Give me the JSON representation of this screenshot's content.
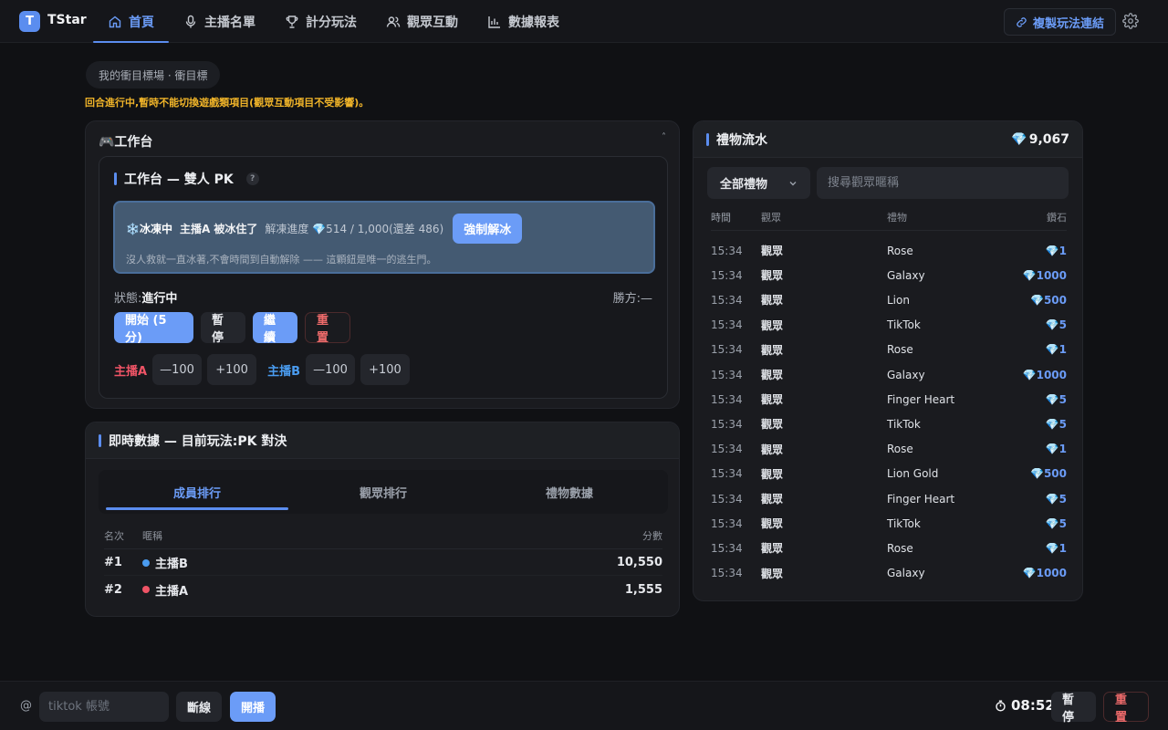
{
  "app": {
    "logo_letter": "T",
    "name": "TStar"
  },
  "nav": [
    {
      "label": "首頁",
      "icon": "home-icon",
      "active": true
    },
    {
      "label": "主播名單",
      "icon": "microphone-icon"
    },
    {
      "label": "計分玩法",
      "icon": "trophy-icon"
    },
    {
      "label": "觀眾互動",
      "icon": "users-icon"
    },
    {
      "label": "數據報表",
      "icon": "bar-chart-icon"
    }
  ],
  "header": {
    "copy_link_label": "複製玩法連結"
  },
  "stage": {
    "pill": "我的衝目標場 · 衝目標",
    "warning": "回合進行中,暫時不能切換遊戲類項目(觀眾互動項目不受影響)。"
  },
  "workbench": {
    "title": "🎮工作台",
    "collapse_glyph": "˄",
    "inner_title": "工作台 — 雙人 PK",
    "help": "?",
    "freeze": {
      "state": "❄️冰凍中",
      "who": "主播A 被冰住了",
      "progress": "解凍進度 💎514 / 1,000(還差 486)",
      "button": "強制解冰",
      "note": "沒人救就一直冰著,不會時間到自動解除 —— 這顆鈕是唯一的逃生門。"
    },
    "status_label": "狀態:",
    "status_value": "進行中",
    "winner": "勝方:—",
    "controls": {
      "start": "開始 (5 分)",
      "pause": "暫停",
      "resume": "繼續",
      "reset": "重置"
    },
    "scores": {
      "a_label": "主播A",
      "b_label": "主播B",
      "minus": "—100",
      "plus": "+100"
    },
    "colors": {
      "a": "#ef5466",
      "b": "#4a9cf0"
    }
  },
  "live": {
    "title": "即時數據 — 目前玩法:PK 對決",
    "tabs": [
      "成員排行",
      "觀眾排行",
      "禮物數據"
    ],
    "columns": {
      "rank": "名次",
      "name": "暱稱",
      "score": "分數"
    },
    "rows": [
      {
        "rank": "#1",
        "name": "主播B",
        "score": "10,550",
        "color": "#4a9cf0"
      },
      {
        "rank": "#2",
        "name": "主播A",
        "score": "1,555",
        "color": "#ef5466"
      }
    ]
  },
  "gifts": {
    "title": "禮物流水",
    "total": "9,067",
    "filter": "全部禮物",
    "search_placeholder": "搜尋觀眾暱稱",
    "columns": {
      "time": "時間",
      "viewer": "觀眾",
      "gift": "禮物",
      "diamonds": "鑽石"
    },
    "rows": [
      {
        "time": "15:34",
        "viewer": "觀眾",
        "gift": "Rose",
        "diamonds": "1"
      },
      {
        "time": "15:34",
        "viewer": "觀眾",
        "gift": "Galaxy",
        "diamonds": "1000"
      },
      {
        "time": "15:34",
        "viewer": "觀眾",
        "gift": "Lion",
        "diamonds": "500"
      },
      {
        "time": "15:34",
        "viewer": "觀眾",
        "gift": "TikTok",
        "diamonds": "5"
      },
      {
        "time": "15:34",
        "viewer": "觀眾",
        "gift": "Rose",
        "diamonds": "1"
      },
      {
        "time": "15:34",
        "viewer": "觀眾",
        "gift": "Galaxy",
        "diamonds": "1000"
      },
      {
        "time": "15:34",
        "viewer": "觀眾",
        "gift": "Finger Heart",
        "diamonds": "5"
      },
      {
        "time": "15:34",
        "viewer": "觀眾",
        "gift": "TikTok",
        "diamonds": "5"
      },
      {
        "time": "15:34",
        "viewer": "觀眾",
        "gift": "Rose",
        "diamonds": "1"
      },
      {
        "time": "15:34",
        "viewer": "觀眾",
        "gift": "Lion Gold",
        "diamonds": "500"
      },
      {
        "time": "15:34",
        "viewer": "觀眾",
        "gift": "Finger Heart",
        "diamonds": "5"
      },
      {
        "time": "15:34",
        "viewer": "觀眾",
        "gift": "TikTok",
        "diamonds": "5"
      },
      {
        "time": "15:34",
        "viewer": "觀眾",
        "gift": "Rose",
        "diamonds": "1"
      },
      {
        "time": "15:34",
        "viewer": "觀眾",
        "gift": "Galaxy",
        "diamonds": "1000"
      }
    ]
  },
  "bottom": {
    "at": "@",
    "account_placeholder": "tiktok 帳號",
    "disconnect": "斷線",
    "broadcast": "開播",
    "timer": "08:52",
    "pause": "暫停",
    "reset": "重置"
  },
  "theme": {
    "accent": "#5b8def",
    "warning": "#f0b429",
    "danger": "#ef6b6b",
    "background": "#101114"
  }
}
